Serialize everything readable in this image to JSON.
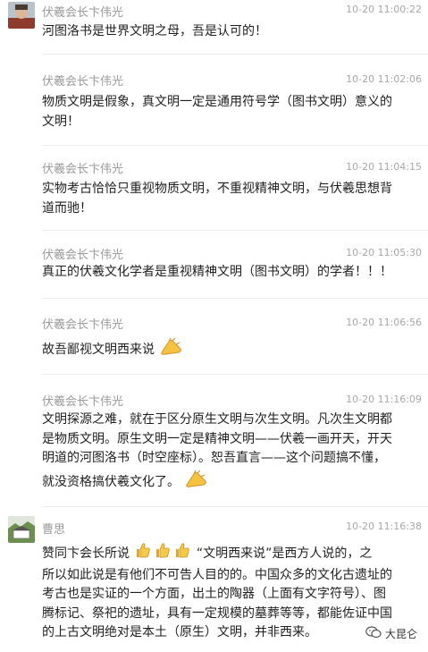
{
  "messages": [
    {
      "name": "伏羲会长卞伟光",
      "time": "10-20 11:00:22",
      "lines": [
        "河图洛书是世界文明之母，吾是认可的！"
      ]
    },
    {
      "name": "伏羲会长卞伟光",
      "time": "10-20 11:02:06",
      "lines": [
        "物质文明是假象，真文明一定是通用符号学（图书文明）意义的",
        "文明！"
      ]
    },
    {
      "name": "伏羲会长卞伟光",
      "time": "10-20 11:04:15",
      "lines": [
        "实物考古恰恰只重视物质文明，不重视精神文明，与伏羲思想背",
        "道而驰！"
      ]
    },
    {
      "name": "伏羲会长卞伟光",
      "time": "10-20 11:05:30",
      "lines": [
        "真正的伏羲文化学者是重视精神文明（图书文明）的学者！！！"
      ]
    },
    {
      "name": "伏羲会长卞伟光",
      "time": "10-20 11:06:56",
      "lines": [
        "故吾鄙视文明西来说"
      ]
    },
    {
      "name": "伏羲会长卞伟光",
      "time": "10-20 11:16:09",
      "lines": [
        "文明探源之难，就在于区分原生文明与次生文明。凡次生文明都",
        "是物质文明。原生文明一定是精神文明——伏羲一画开天，开天",
        "明道的河图洛书（时空座标）。恕吾直言——这个问题搞不懂，",
        "就没资格搞伏羲文化了。"
      ]
    },
    {
      "name": "曹思",
      "time": "10-20 11:16:38",
      "lines": [
        "赞同卞会长所说",
        "“文明西来说”是西方人说的，之",
        "所以如此说是有他们不可告人目的的。中国众多的文化古遗址的",
        "考古也是实证的一个方面，出土的陶器（上面有文字符号）、图",
        "腾标记、祭祀的遗址，具有一定规模的墓葬等等，都能佐证中国",
        "的上古文明绝对是本土（原生）文明，并非西来。"
      ]
    }
  ],
  "watermark": {
    "text": "大昆仑",
    "icon": "wechat-icon"
  }
}
